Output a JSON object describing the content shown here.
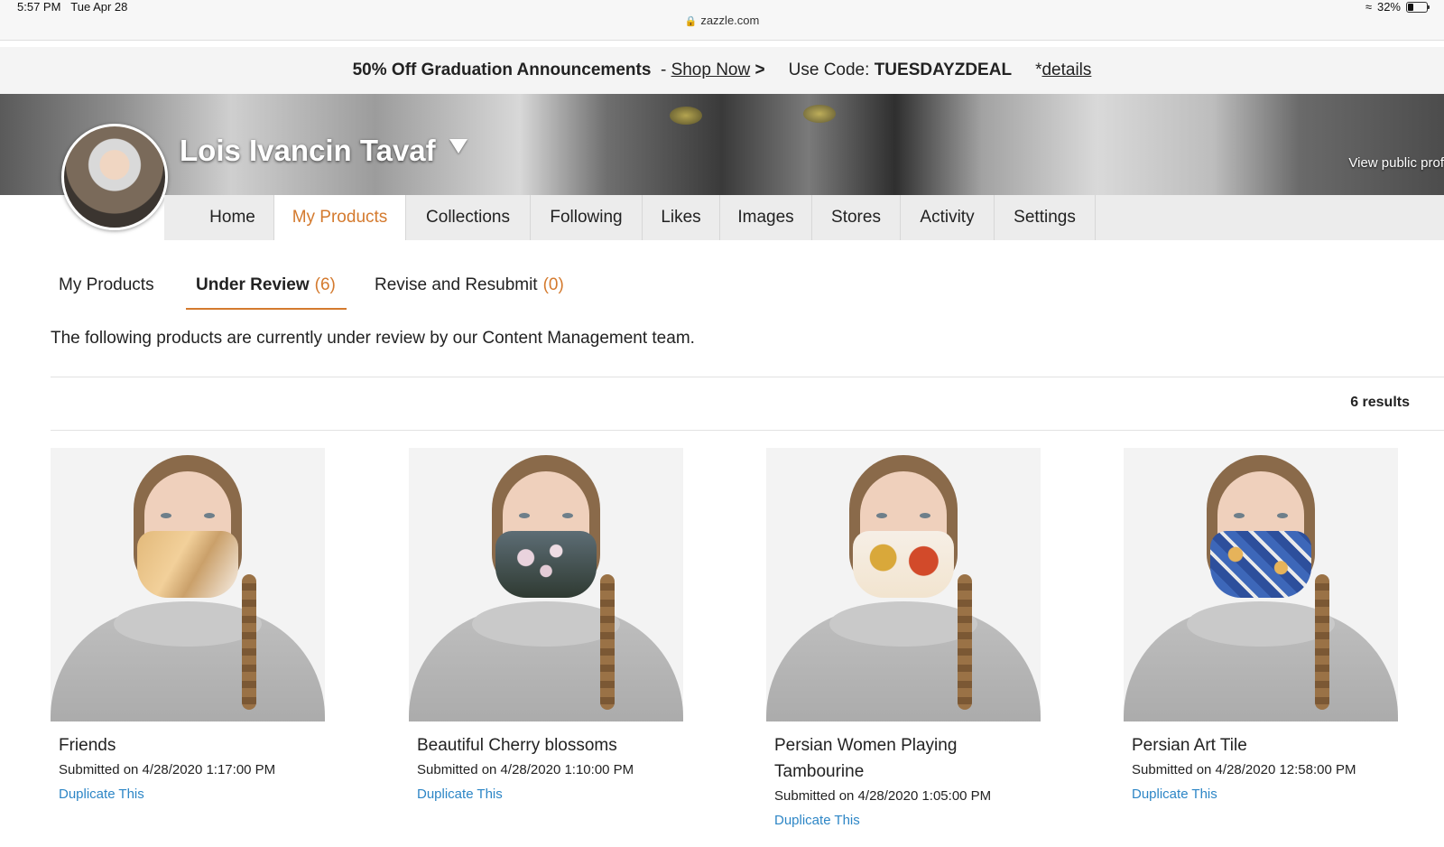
{
  "status_bar": {
    "time": "5:57 PM",
    "date": "Tue Apr 28",
    "url": "zazzle.com",
    "battery": "32%",
    "battery_level": 0.32
  },
  "promo": {
    "headline": "50% Off Graduation Announcements",
    "separator": "-",
    "shop_link": "Shop Now",
    "shop_arrow": ">",
    "code_label": "Use Code:",
    "code": "TUESDAYZDEAL",
    "details_prefix": "*",
    "details_link": "details"
  },
  "profile": {
    "name": "Lois Ivancin Tavaf",
    "view_public_profile": "View public prof"
  },
  "nav": {
    "tabs": [
      {
        "label": "Home",
        "active": false
      },
      {
        "label": "My Products",
        "active": true
      },
      {
        "label": "Collections",
        "active": false
      },
      {
        "label": "Following",
        "active": false
      },
      {
        "label": "Likes",
        "active": false
      },
      {
        "label": "Images",
        "active": false
      },
      {
        "label": "Stores",
        "active": false
      },
      {
        "label": "Activity",
        "active": false
      },
      {
        "label": "Settings",
        "active": false
      }
    ]
  },
  "subtabs": [
    {
      "label": "My Products",
      "count": "",
      "active": false
    },
    {
      "label": "Under Review",
      "count": "(6)",
      "active": true
    },
    {
      "label": "Revise and Resubmit",
      "count": "(0)",
      "active": false
    }
  ],
  "review_note": "The following products are currently under review by our Content Management team.",
  "results_count": "6 results",
  "products": [
    {
      "title": "Friends",
      "submitted": "Submitted on 4/28/2020 1:17:00 PM",
      "duplicate": "Duplicate This"
    },
    {
      "title": "Beautiful Cherry blossoms",
      "submitted": "Submitted on 4/28/2020 1:10:00 PM",
      "duplicate": "Duplicate This"
    },
    {
      "title": "Persian Women Playing Tambourine",
      "submitted": "Submitted on 4/28/2020 1:05:00 PM",
      "duplicate": "Duplicate This"
    },
    {
      "title": "Persian Art Tile",
      "submitted": "Submitted on 4/28/2020 12:58:00 PM",
      "duplicate": "Duplicate This"
    }
  ],
  "colors": {
    "accent": "#d47a2e",
    "link": "#2d86c6",
    "nav_bg": "#ececec"
  }
}
